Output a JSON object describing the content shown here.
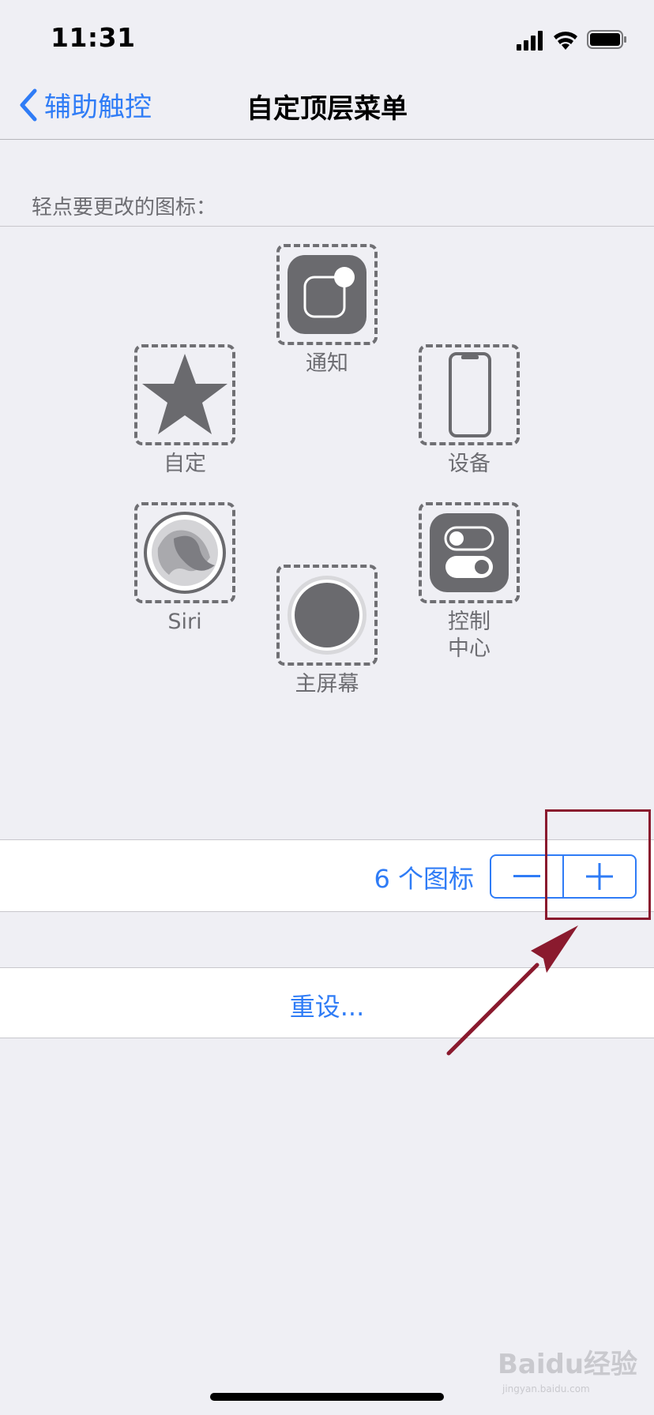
{
  "status_bar": {
    "time": "11:31"
  },
  "nav": {
    "back_label": "辅助触控",
    "title": "自定顶层菜单"
  },
  "section": {
    "header": "轻点要更改的图标："
  },
  "icons": [
    {
      "name": "notification",
      "label": "通知",
      "icon": "notification-icon"
    },
    {
      "name": "custom",
      "label": "自定",
      "icon": "star-icon"
    },
    {
      "name": "device",
      "label": "设备",
      "icon": "phone-icon"
    },
    {
      "name": "siri",
      "label": "Siri",
      "icon": "siri-icon"
    },
    {
      "name": "control-center",
      "label": "控制\n中心",
      "icon": "toggle-icon"
    },
    {
      "name": "home",
      "label": "主屏幕",
      "icon": "home-button-icon"
    }
  ],
  "count_row": {
    "label": "6 个图标",
    "minus": "—",
    "plus": "+"
  },
  "reset": {
    "label": "重设..."
  },
  "watermark": {
    "text": "Baidu经验",
    "sub": "jingyan.baidu.com"
  },
  "colors": {
    "accent": "#2f7cf6",
    "icon_fill": "#6a6a6e",
    "annotation": "#8a1a2e",
    "background": "#efeff4"
  }
}
